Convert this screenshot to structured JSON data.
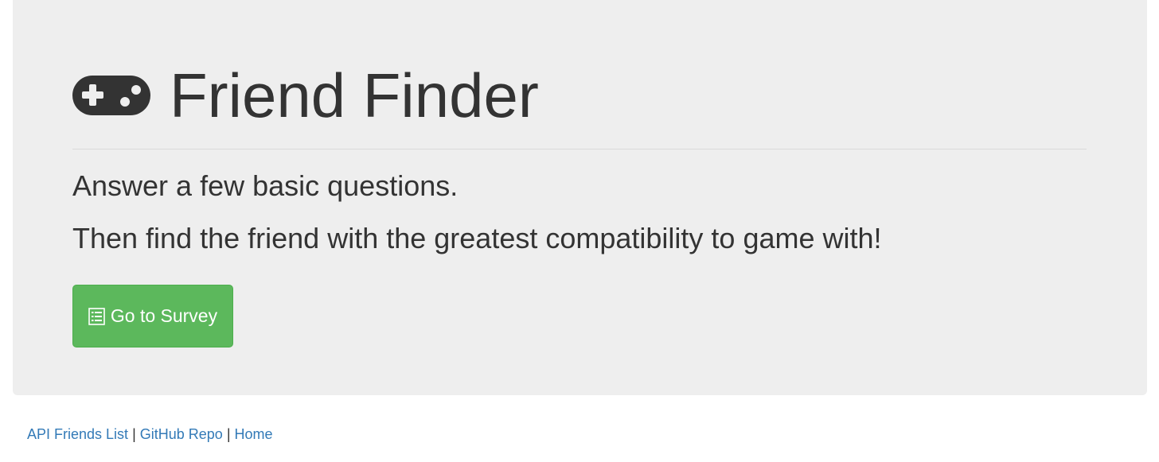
{
  "header": {
    "icon": "gamepad-icon",
    "title": "Friend Finder"
  },
  "intro": {
    "line1": "Answer a few basic questions.",
    "line2": "Then find the friend with the greatest compatibility to game with!"
  },
  "survey_button": {
    "icon": "list-icon",
    "label": "Go to Survey",
    "color": "#5cb85c"
  },
  "footer": {
    "links": [
      "API Friends List",
      "GitHub Repo",
      "Home"
    ],
    "separator": "|",
    "link_color": "#337ab7"
  },
  "colors": {
    "panel_background": "#eeeeee",
    "text": "#333333"
  }
}
